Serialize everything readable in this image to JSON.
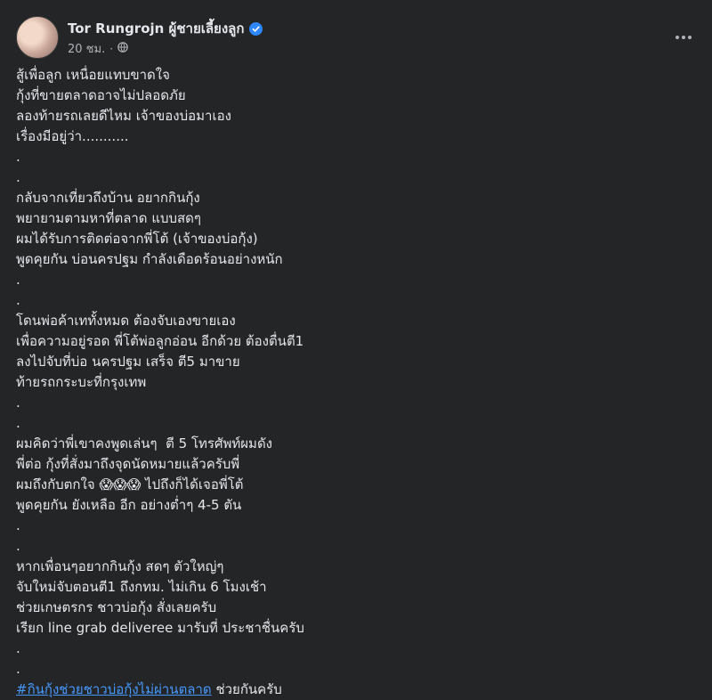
{
  "post": {
    "author": "Tor Rungrojn ผู้ชายเลี้ยงลูก",
    "time": "20 ชม.",
    "separator": "·",
    "lines": [
      "สู้เพื่อลูก เหนื่อยแทบขาดใจ",
      "กุ้งที่ขายตลาดอาจไม่ปลอดภัย",
      "ลองท้ายรถเลยดีไหม เจ้าของบ่อมาเอง",
      "เรื่องมีอยู่ว่า...........",
      ".",
      ".",
      "กลับจากเที่ยวถึงบ้าน อยากกินกุ้ง",
      "พยายามตามหาที่ตลาด แบบสดๆ",
      "ผมได้รับการติดต่อจากพี่โต้ (เจ้าของบ่อกุ้ง)",
      "พูดคุยกัน บ่อนครปฐม กำลังเดือดร้อนอย่างหนัก",
      ".",
      ".",
      "โดนพ่อค้าเททั้งหมด ต้องจับเองขายเอง",
      "เพื่อความอยู่รอด พี่โต้พ่อลูกอ่อน อีกด้วย ต้องตื่นตี1",
      "ลงไปจับที่บ่อ นครปฐม เสร็จ ตี5 มาขาย",
      "ท้ายรถกระบะที่กรุงเทพ",
      ".",
      ".",
      "ผมคิดว่าพี่เขาคงพูดเล่นๆ  ตี 5 โทรศัพท์ผมดัง",
      "พี่ต่อ กุ้งที่สั่งมาถึงจุดนัดหมายแล้วครับพี่",
      "ผมถึงกับตกใจ 😱😱😱 ไปถึงก็ได้เจอพี่โต้",
      "พูดคุยกัน ยังเหลือ อีก อย่างต่ำๆ 4-5 ตัน",
      ".",
      ".",
      "หากเพื่อนๆอยากกินกุ้ง สดๆ ตัวใหญ่ๆ",
      "จับใหม่จับตอนตี1 ถึงกทม. ไม่เกิน 6 โมงเช้า",
      "ช่วยเกษตรกร ชาวบ่อกุ้ง สั่งเลยครับ",
      "เรียก line grab deliveree มารับที่ ประชาชื่นครับ",
      ".",
      "."
    ],
    "hashtag": "#กินกุ้งช่วยชาวบ่อกุ้งไม่ผ่านตลาด",
    "hashtag_suffix": " ช่วยกันครับ"
  }
}
